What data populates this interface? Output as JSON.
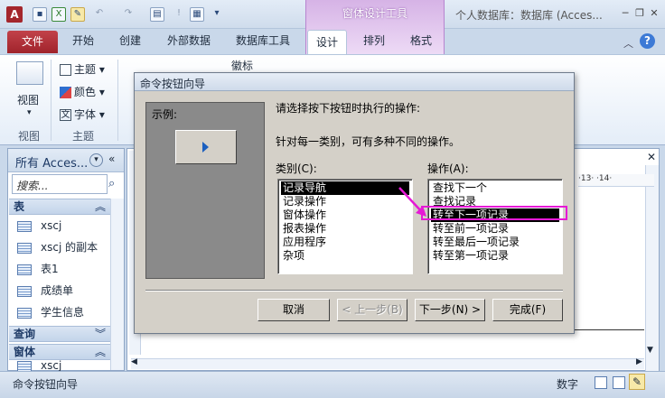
{
  "title_bar": {
    "app_letter": "A",
    "contextual_group": "窗体设计工具",
    "window_title": "个人数据库：数据库 (Acces...",
    "minimize": "─",
    "restore": "❐",
    "close": "✕"
  },
  "tabs": [
    "文件",
    "开始",
    "创建",
    "外部数据",
    "数据库工具",
    "设计",
    "排列",
    "格式"
  ],
  "ribbon": {
    "view_label": "视图",
    "theme_items": [
      "主题",
      "颜色",
      "字体"
    ],
    "badge_label": "徽标",
    "groups": [
      "视图",
      "主题"
    ]
  },
  "nav_pane": {
    "title": "所有 Acces...",
    "search_placeholder": "搜索...",
    "sections": {
      "tables": "表",
      "queries": "查询",
      "forms": "窗体"
    },
    "table_items": [
      "xscj",
      "xscj 的副本",
      "表1",
      "成绩单",
      "学生信息"
    ],
    "form_items": [
      "xscj"
    ]
  },
  "ruler": {
    "marks": "·13· ·14·"
  },
  "dialog": {
    "title": "命令按钮向导",
    "example_label": "示例:",
    "prompt": "请选择按下按钮时执行的操作:",
    "hint": "针对每一类别，可有多种不同的操作。",
    "category_label": "类别(C):",
    "action_label": "操作(A):",
    "categories": [
      "记录导航",
      "记录操作",
      "窗体操作",
      "报表操作",
      "应用程序",
      "杂项"
    ],
    "selected_category": 0,
    "actions": [
      "查找下一个",
      "查找记录",
      "转至下一项记录",
      "转至前一项记录",
      "转至最后一项记录",
      "转至第一项记录"
    ],
    "selected_action": 2,
    "buttons": {
      "cancel": "取消",
      "back": "< 上一步(B)",
      "next": "下一步(N) >",
      "finish": "完成(F)"
    }
  },
  "status_bar": {
    "left_text": "命令按钮向导",
    "mode": "数字"
  },
  "colors": {
    "highlight": "#e619d6",
    "file_tab": "#a0232b",
    "selection": "#000000"
  }
}
